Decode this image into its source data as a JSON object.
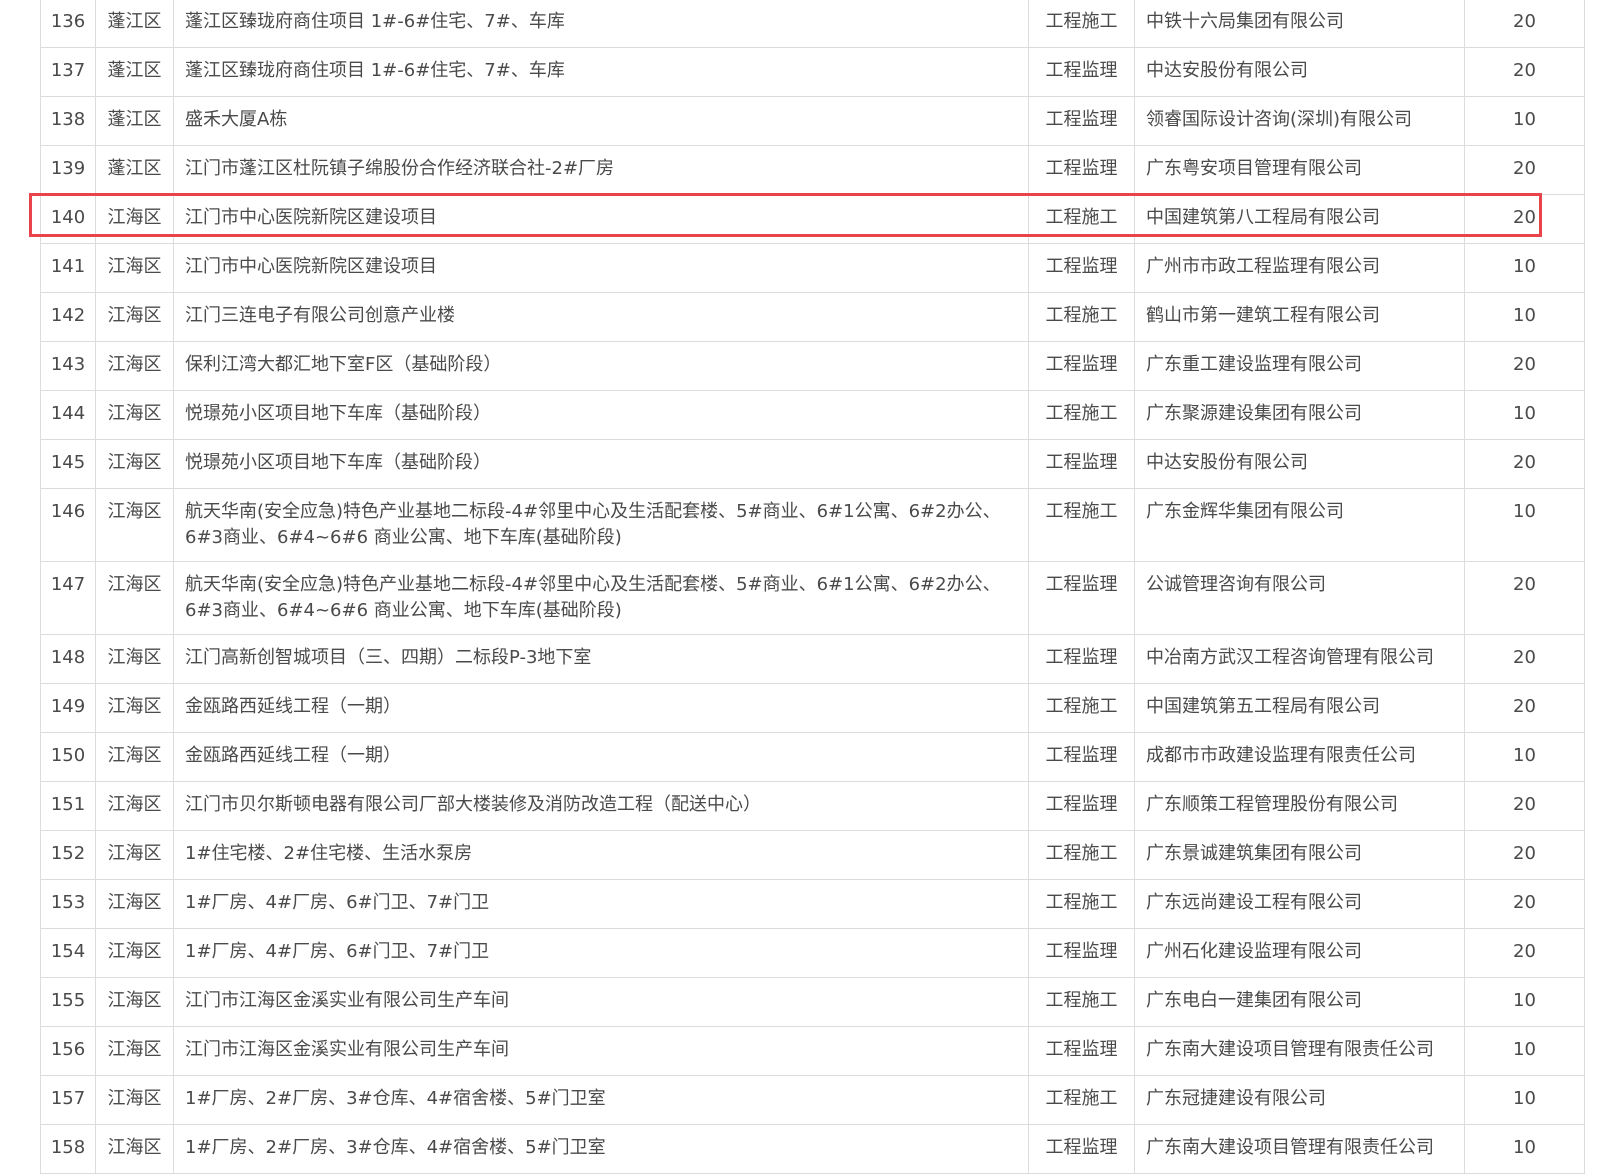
{
  "table": {
    "rows": [
      {
        "no": "136",
        "area": "蓬江区",
        "project": "蓬江区臻珑府商住项目 1#-6#住宅、7#、车库",
        "type": "工程施工",
        "company": "中铁十六局集团有限公司",
        "score": "20"
      },
      {
        "no": "137",
        "area": "蓬江区",
        "project": "蓬江区臻珑府商住项目 1#-6#住宅、7#、车库",
        "type": "工程监理",
        "company": "中达安股份有限公司",
        "score": "20"
      },
      {
        "no": "138",
        "area": "蓬江区",
        "project": "盛禾大厦A栋",
        "type": "工程监理",
        "company": "领睿国际设计咨询(深圳)有限公司",
        "score": "10"
      },
      {
        "no": "139",
        "area": "蓬江区",
        "project": "江门市蓬江区杜阮镇子绵股份合作经济联合社-2#厂房",
        "type": "工程监理",
        "company": "广东粤安项目管理有限公司",
        "score": "20"
      },
      {
        "no": "140",
        "area": "江海区",
        "project": "江门市中心医院新院区建设项目",
        "type": "工程施工",
        "company": "中国建筑第八工程局有限公司",
        "score": "20"
      },
      {
        "no": "141",
        "area": "江海区",
        "project": "江门市中心医院新院区建设项目",
        "type": "工程监理",
        "company": "广州市市政工程监理有限公司",
        "score": "10"
      },
      {
        "no": "142",
        "area": "江海区",
        "project": "江门三连电子有限公司创意产业楼",
        "type": "工程施工",
        "company": "鹤山市第一建筑工程有限公司",
        "score": "10"
      },
      {
        "no": "143",
        "area": "江海区",
        "project": "保利江湾大都汇地下室F区（基础阶段）",
        "type": "工程监理",
        "company": "广东重工建设监理有限公司",
        "score": "20"
      },
      {
        "no": "144",
        "area": "江海区",
        "project": "悦璟苑小区项目地下车库（基础阶段）",
        "type": "工程施工",
        "company": "广东聚源建设集团有限公司",
        "score": "10"
      },
      {
        "no": "145",
        "area": "江海区",
        "project": "悦璟苑小区项目地下车库（基础阶段）",
        "type": "工程监理",
        "company": "中达安股份有限公司",
        "score": "20"
      },
      {
        "no": "146",
        "area": "江海区",
        "project": "航天华南(安全应急)特色产业基地二标段-4#邻里中心及生活配套楼、5#商业、6#1公寓、6#2办公、6#3商业、6#4~6#6 商业公寓、地下车库(基础阶段)",
        "type": "工程施工",
        "company": "广东金辉华集团有限公司",
        "score": "10"
      },
      {
        "no": "147",
        "area": "江海区",
        "project": "航天华南(安全应急)特色产业基地二标段-4#邻里中心及生活配套楼、5#商业、6#1公寓、6#2办公、6#3商业、6#4~6#6 商业公寓、地下车库(基础阶段)",
        "type": "工程监理",
        "company": "公诚管理咨询有限公司",
        "score": "20"
      },
      {
        "no": "148",
        "area": "江海区",
        "project": "江门高新创智城项目（三、四期）二标段P-3地下室",
        "type": "工程监理",
        "company": "中冶南方武汉工程咨询管理有限公司",
        "score": "20"
      },
      {
        "no": "149",
        "area": "江海区",
        "project": "金瓯路西延线工程（一期）",
        "type": "工程施工",
        "company": "中国建筑第五工程局有限公司",
        "score": "20"
      },
      {
        "no": "150",
        "area": "江海区",
        "project": "金瓯路西延线工程（一期）",
        "type": "工程监理",
        "company": "成都市市政建设监理有限责任公司",
        "score": "10"
      },
      {
        "no": "151",
        "area": "江海区",
        "project": "江门市贝尔斯顿电器有限公司厂部大楼装修及消防改造工程（配送中心）",
        "type": "工程监理",
        "company": "广东顺策工程管理股份有限公司",
        "score": "20"
      },
      {
        "no": "152",
        "area": "江海区",
        "project": "1#住宅楼、2#住宅楼、生活水泵房",
        "type": "工程施工",
        "company": "广东景诚建筑集团有限公司",
        "score": "20"
      },
      {
        "no": "153",
        "area": "江海区",
        "project": "1#厂房、4#厂房、6#门卫、7#门卫",
        "type": "工程施工",
        "company": "广东远尚建设工程有限公司",
        "score": "20"
      },
      {
        "no": "154",
        "area": "江海区",
        "project": "1#厂房、4#厂房、6#门卫、7#门卫",
        "type": "工程监理",
        "company": "广州石化建设监理有限公司",
        "score": "20"
      },
      {
        "no": "155",
        "area": "江海区",
        "project": "江门市江海区金溪实业有限公司生产车间",
        "type": "工程施工",
        "company": "广东电白一建集团有限公司",
        "score": "10"
      },
      {
        "no": "156",
        "area": "江海区",
        "project": "江门市江海区金溪实业有限公司生产车间",
        "type": "工程监理",
        "company": "广东南大建设项目管理有限责任公司",
        "score": "10"
      },
      {
        "no": "157",
        "area": "江海区",
        "project": "1#厂房、2#厂房、3#仓库、4#宿舍楼、5#门卫室",
        "type": "工程施工",
        "company": "广东冠捷建设有限公司",
        "score": "10"
      },
      {
        "no": "158",
        "area": "江海区",
        "project": "1#厂房、2#厂房、3#仓库、4#宿舍楼、5#门卫室",
        "type": "工程监理",
        "company": "广东南大建设项目管理有限责任公司",
        "score": "10"
      }
    ]
  },
  "highlight": {
    "row_no": "140",
    "color": "#e8444c"
  }
}
